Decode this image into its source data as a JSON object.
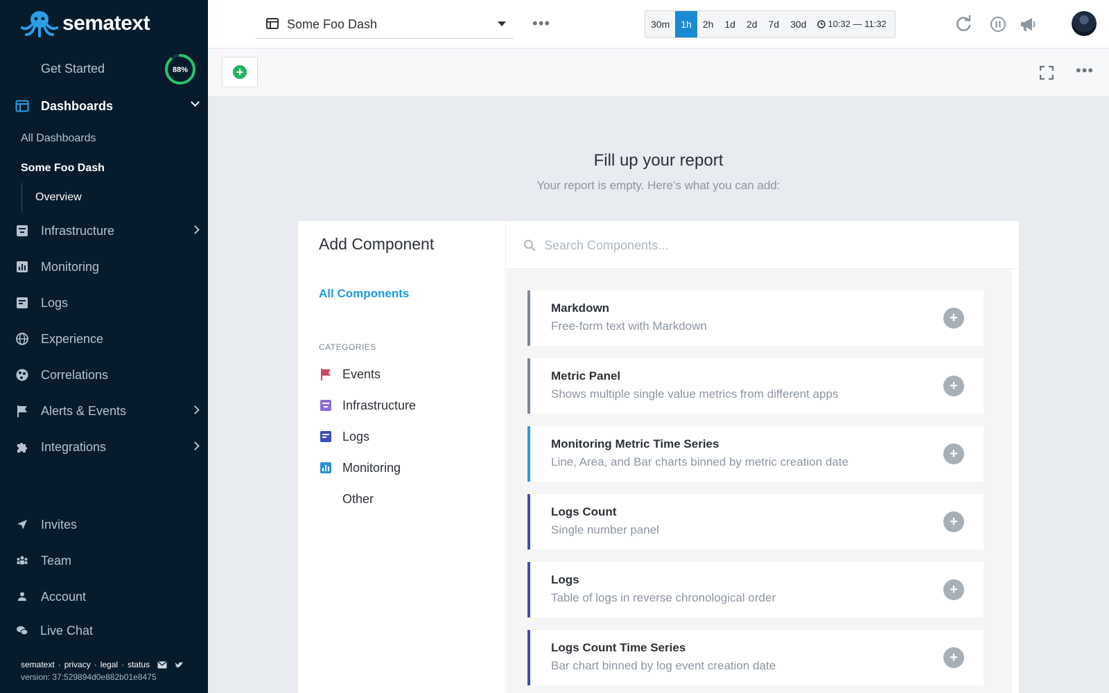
{
  "brand": {
    "name": "sematext"
  },
  "sidebar": {
    "get_started": {
      "label": "Get Started",
      "progress_text": "88%",
      "progress": 0.88
    },
    "dashboards": {
      "label": "Dashboards",
      "all": "All Dashboards",
      "current": "Some Foo Dash",
      "overview": "Overview"
    },
    "items": [
      {
        "label": "Infrastructure",
        "icon": "infrastructure-icon"
      },
      {
        "label": "Monitoring",
        "icon": "monitoring-icon"
      },
      {
        "label": "Logs",
        "icon": "logs-icon"
      },
      {
        "label": "Experience",
        "icon": "globe-icon"
      },
      {
        "label": "Correlations",
        "icon": "correlations-icon"
      },
      {
        "label": "Alerts & Events",
        "icon": "flag-icon"
      },
      {
        "label": "Integrations",
        "icon": "puzzle-icon"
      }
    ],
    "bottom": [
      {
        "label": "Invites",
        "icon": "send-icon"
      },
      {
        "label": "Team",
        "icon": "team-icon"
      },
      {
        "label": "Account",
        "icon": "user-icon"
      },
      {
        "label": "Live Chat",
        "icon": "chat-icon"
      }
    ],
    "footer": {
      "links": [
        "sematext",
        "·",
        "privacy",
        "·",
        "legal",
        "·",
        "status"
      ],
      "version": "version: 37:529894d0e882b01e8475"
    }
  },
  "topbar": {
    "dashboard_name": "Some Foo Dash",
    "time_ranges": [
      "30m",
      "1h",
      "2h",
      "1d",
      "2d",
      "7d",
      "30d"
    ],
    "selected_range": "1h",
    "time_window": "10:32 — 11:32"
  },
  "main": {
    "title": "Fill up your report",
    "subtitle": "Your report is empty. Here’s what you can add:"
  },
  "add_component": {
    "title": "Add Component",
    "all_components": "All Components",
    "categories_heading": "CATEGORIES",
    "categories": [
      {
        "label": "Events",
        "icon": "flag-icon",
        "color": "#c84b5c"
      },
      {
        "label": "Infrastructure",
        "icon": "infrastructure-icon",
        "color": "#8e6bd6"
      },
      {
        "label": "Logs",
        "icon": "logs-icon",
        "color": "#3b4fb8"
      },
      {
        "label": "Monitoring",
        "icon": "monitoring-icon",
        "color": "#2b8fd6"
      },
      {
        "label": "Other",
        "icon": "",
        "color": ""
      }
    ],
    "search_placeholder": "Search Components...",
    "components": [
      {
        "title": "Markdown",
        "description": "Free-form text with Markdown",
        "accent": "#7d8792"
      },
      {
        "title": "Metric Panel",
        "description": "Shows multiple single value metrics from different apps",
        "accent": "#7d8792"
      },
      {
        "title": "Monitoring Metric Time Series",
        "description": "Line, Area, and Bar charts binned by metric creation date",
        "accent": "#2b9be0"
      },
      {
        "title": "Logs Count",
        "description": "Single number panel",
        "accent": "#3b4fb8"
      },
      {
        "title": "Logs",
        "description": "Table of logs in reverse chronological order",
        "accent": "#3b4fb8"
      },
      {
        "title": "Logs Count Time Series",
        "description": "Bar chart binned by log event creation date",
        "accent": "#3b4fb8"
      }
    ]
  },
  "colors": {
    "sidebar_bg": "#061b2b",
    "accent_blue": "#1a8bd3",
    "add_green": "#27b260"
  }
}
